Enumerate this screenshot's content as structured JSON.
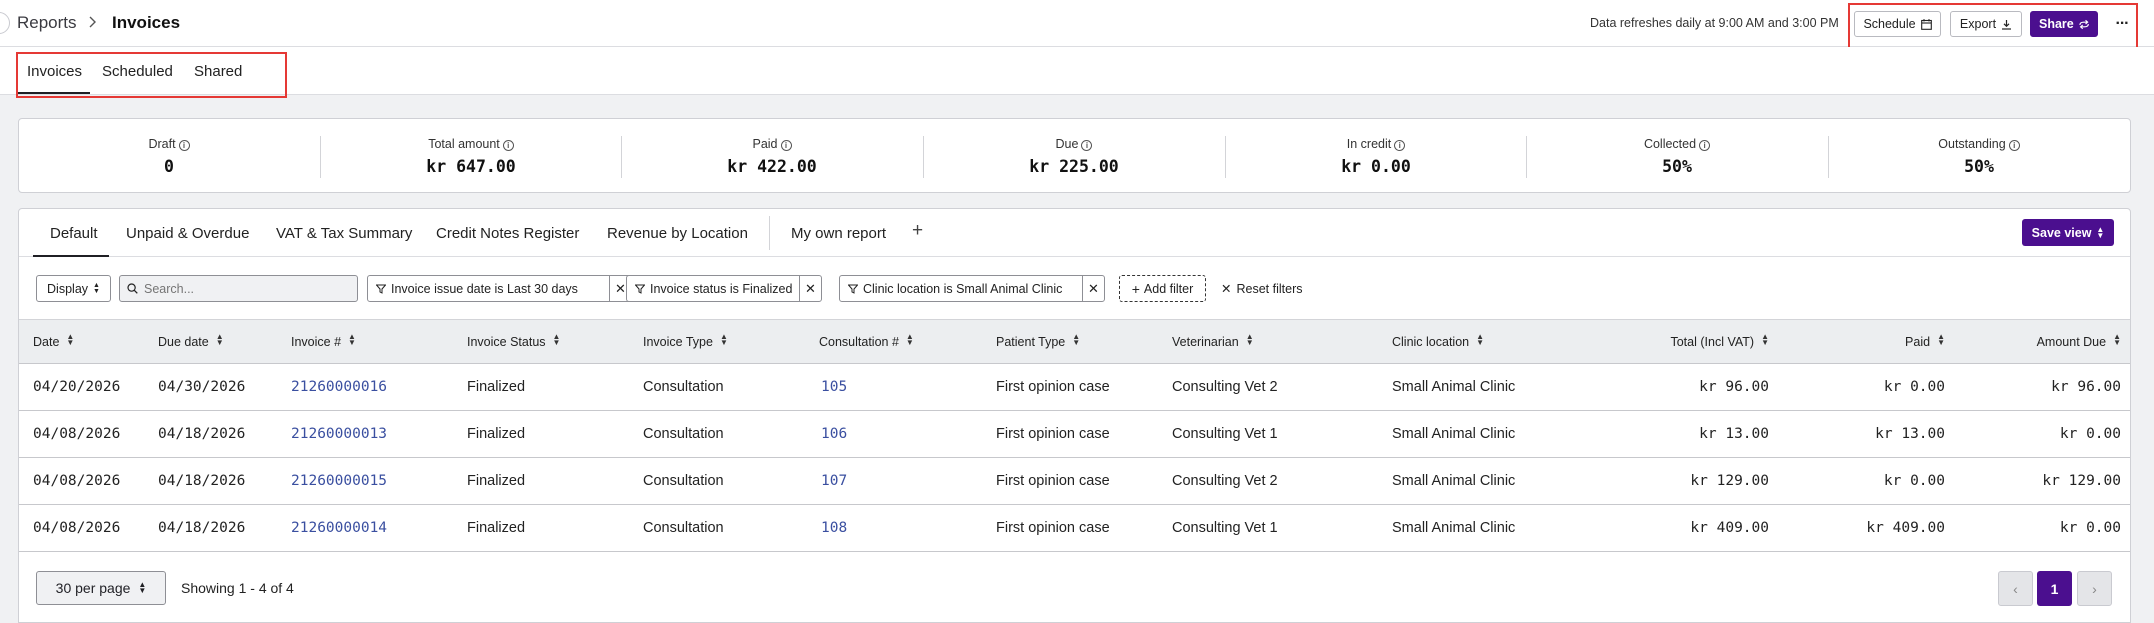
{
  "breadcrumb": {
    "root": "Reports",
    "current": "Invoices"
  },
  "header": {
    "refresh_note": "Data refreshes daily at 9:00 AM and 3:00 PM",
    "schedule_label": "Schedule",
    "export_label": "Export",
    "share_label": "Share",
    "more_label": "···"
  },
  "page_tabs": [
    {
      "label": "Invoices",
      "active": true
    },
    {
      "label": "Scheduled",
      "active": false
    },
    {
      "label": "Shared",
      "active": false
    }
  ],
  "summary": [
    {
      "label": "Draft",
      "value": "0"
    },
    {
      "label": "Total amount",
      "value": "kr 647.00"
    },
    {
      "label": "Paid",
      "value": "kr 422.00"
    },
    {
      "label": "Due",
      "value": "kr 225.00"
    },
    {
      "label": "In credit",
      "value": "kr 0.00"
    },
    {
      "label": "Collected",
      "value": "50%"
    },
    {
      "label": "Outstanding",
      "value": "50%"
    }
  ],
  "view_tabs": [
    {
      "label": "Default",
      "active": true
    },
    {
      "label": "Unpaid & Overdue"
    },
    {
      "label": "VAT & Tax Summary"
    },
    {
      "label": "Credit Notes Register"
    },
    {
      "label": "Revenue by Location"
    },
    {
      "label": "My own report"
    }
  ],
  "add_view_label": "+",
  "save_view_label": "Save view",
  "filters": {
    "display_label": "Display",
    "search_placeholder": "Search...",
    "chips": [
      "Invoice issue date is Last 30 days",
      "Invoice status is Finalized",
      "Clinic location is Small Animal Clinic"
    ],
    "add_filter_label": "Add filter",
    "reset_filters_label": "Reset filters"
  },
  "table": {
    "columns": [
      "Date",
      "Due date",
      "Invoice #",
      "Invoice Status",
      "Invoice Type",
      "Consultation #",
      "Patient Type",
      "Veterinarian",
      "Clinic location",
      "Total (Incl VAT)",
      "Paid",
      "Amount Due"
    ],
    "rows": [
      [
        "04/20/2026",
        "04/30/2026",
        "21260000016",
        "Finalized",
        "Consultation",
        "105",
        "First opinion case",
        "Consulting Vet 2",
        "Small Animal Clinic",
        "kr 96.00",
        "kr 0.00",
        "kr 96.00"
      ],
      [
        "04/08/2026",
        "04/18/2026",
        "21260000013",
        "Finalized",
        "Consultation",
        "106",
        "First opinion case",
        "Consulting Vet 1",
        "Small Animal Clinic",
        "kr 13.00",
        "kr 13.00",
        "kr 0.00"
      ],
      [
        "04/08/2026",
        "04/18/2026",
        "21260000015",
        "Finalized",
        "Consultation",
        "107",
        "First opinion case",
        "Consulting Vet 2",
        "Small Animal Clinic",
        "kr 129.00",
        "kr 0.00",
        "kr 129.00"
      ],
      [
        "04/08/2026",
        "04/18/2026",
        "21260000014",
        "Finalized",
        "Consultation",
        "108",
        "First opinion case",
        "Consulting Vet 1",
        "Small Animal Clinic",
        "kr 409.00",
        "kr 409.00",
        "kr 0.00"
      ]
    ]
  },
  "footer": {
    "per_page_label": "30 per page",
    "showing_text": "Showing 1 - 4 of 4",
    "current_page": "1"
  },
  "colors": {
    "accent": "#4b0f8f",
    "highlight": "#e53935",
    "link": "#3a4fa0"
  }
}
